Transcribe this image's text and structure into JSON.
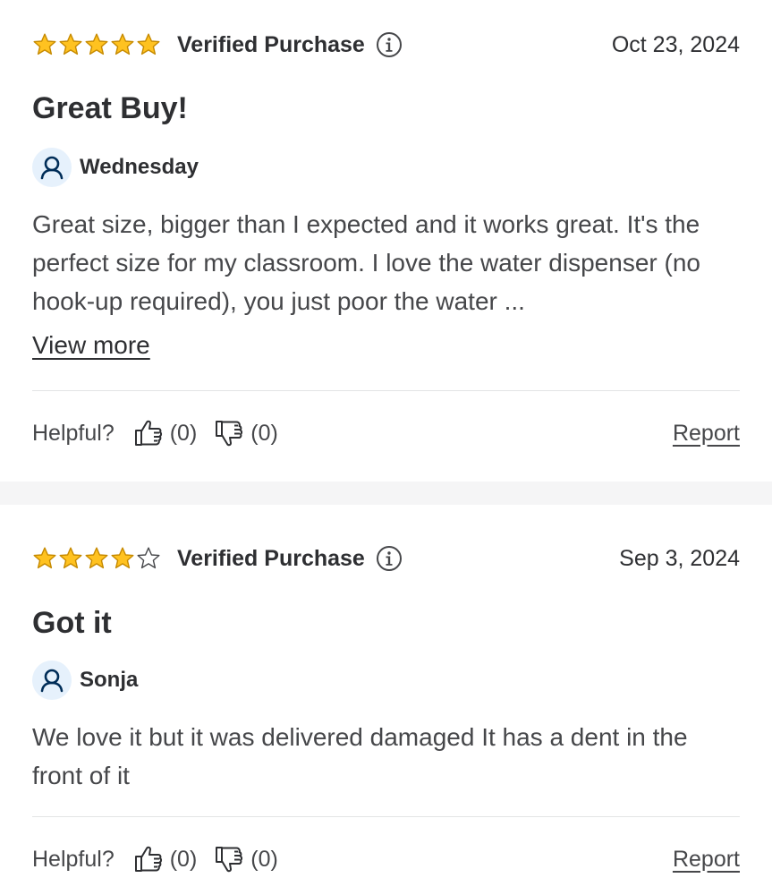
{
  "colors": {
    "star": "#ffc220",
    "star_stroke": "#c68a00",
    "avatar_bg": "#e6f1fc",
    "avatar_icon": "#002d58",
    "separator": "#f5f5f6"
  },
  "reviews": [
    {
      "rating": 5,
      "verified_label": "Verified Purchase",
      "date": "Oct 23, 2024",
      "title": "Great Buy!",
      "author": "Wednesday",
      "text": "Great size, bigger than I expected and it works great. It's the perfect size for my classroom. I love the water dispenser (no hook-up required), you just poor the water ...",
      "view_more": "View more",
      "helpful_label": "Helpful?",
      "up_count": "(0)",
      "down_count": "(0)",
      "report": "Report"
    },
    {
      "rating": 4,
      "verified_label": "Verified Purchase",
      "date": "Sep 3, 2024",
      "title": "Got it",
      "author": "Sonja",
      "text": "We love it but it was delivered damaged It has a dent in the front of it",
      "helpful_label": "Helpful?",
      "up_count": "(0)",
      "down_count": "(0)",
      "report": "Report"
    }
  ]
}
